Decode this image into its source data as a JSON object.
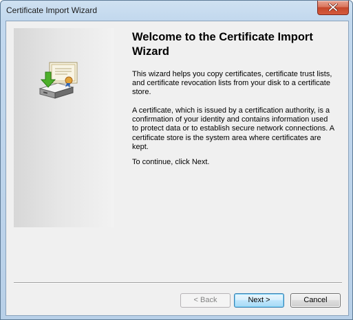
{
  "window": {
    "title": "Certificate Import Wizard",
    "close_icon": "close-icon"
  },
  "side_panel": {
    "icon": "certificate-import-icon"
  },
  "content": {
    "heading": "Welcome to the Certificate Import Wizard",
    "paragraph_1": "This wizard helps you copy certificates, certificate trust lists, and certificate revocation lists from your disk to a certificate store.",
    "paragraph_2": "A certificate, which is issued by a certification authority, is a confirmation of your identity and contains information used to protect data or to establish secure network connections. A certificate store is the system area where certificates are kept.",
    "paragraph_3": "To continue, click Next."
  },
  "buttons": {
    "back_label": "< Back",
    "next_label": "Next >",
    "cancel_label": "Cancel",
    "back_enabled": false
  }
}
